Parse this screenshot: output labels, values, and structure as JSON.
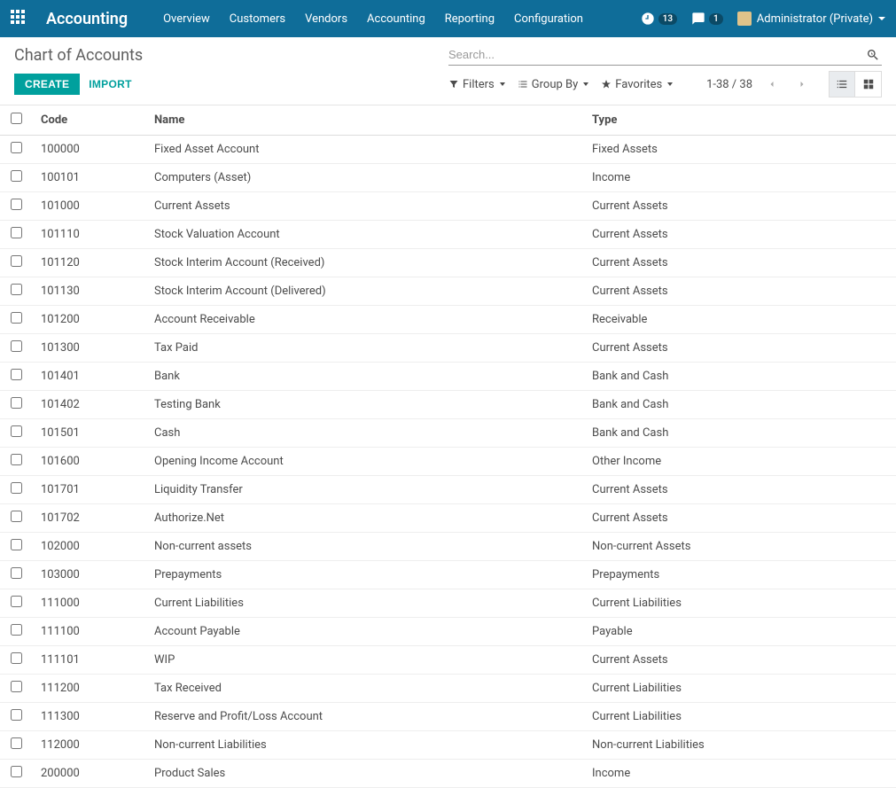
{
  "navbar": {
    "brand": "Accounting",
    "menu": [
      "Overview",
      "Customers",
      "Vendors",
      "Accounting",
      "Reporting",
      "Configuration"
    ],
    "clock_badge": "13",
    "chat_badge": "1",
    "user": "Administrator (Private)"
  },
  "control": {
    "breadcrumb": "Chart of Accounts",
    "search_placeholder": "Search...",
    "create": "CREATE",
    "import": "IMPORT",
    "filters": "Filters",
    "group_by": "Group By",
    "favorites": "Favorites",
    "pager": "1-38 / 38"
  },
  "columns": {
    "code": "Code",
    "name": "Name",
    "type": "Type"
  },
  "rows": [
    {
      "code": "100000",
      "name": "Fixed Asset Account",
      "type": "Fixed Assets"
    },
    {
      "code": "100101",
      "name": "Computers (Asset)",
      "type": "Income"
    },
    {
      "code": "101000",
      "name": "Current Assets",
      "type": "Current Assets"
    },
    {
      "code": "101110",
      "name": "Stock Valuation Account",
      "type": "Current Assets"
    },
    {
      "code": "101120",
      "name": "Stock Interim Account (Received)",
      "type": "Current Assets"
    },
    {
      "code": "101130",
      "name": "Stock Interim Account (Delivered)",
      "type": "Current Assets"
    },
    {
      "code": "101200",
      "name": "Account Receivable",
      "type": "Receivable"
    },
    {
      "code": "101300",
      "name": "Tax Paid",
      "type": "Current Assets"
    },
    {
      "code": "101401",
      "name": "Bank",
      "type": "Bank and Cash"
    },
    {
      "code": "101402",
      "name": "Testing Bank",
      "type": "Bank and Cash"
    },
    {
      "code": "101501",
      "name": "Cash",
      "type": "Bank and Cash"
    },
    {
      "code": "101600",
      "name": "Opening Income Account",
      "type": "Other Income"
    },
    {
      "code": "101701",
      "name": "Liquidity Transfer",
      "type": "Current Assets"
    },
    {
      "code": "101702",
      "name": "Authorize.Net",
      "type": "Current Assets"
    },
    {
      "code": "102000",
      "name": "Non-current assets",
      "type": "Non-current Assets"
    },
    {
      "code": "103000",
      "name": "Prepayments",
      "type": "Prepayments"
    },
    {
      "code": "111000",
      "name": "Current Liabilities",
      "type": "Current Liabilities"
    },
    {
      "code": "111100",
      "name": "Account Payable",
      "type": "Payable"
    },
    {
      "code": "111101",
      "name": "WIP",
      "type": "Current Assets"
    },
    {
      "code": "111200",
      "name": "Tax Received",
      "type": "Current Liabilities"
    },
    {
      "code": "111300",
      "name": "Reserve and Profit/Loss Account",
      "type": "Current Liabilities"
    },
    {
      "code": "112000",
      "name": "Non-current Liabilities",
      "type": "Non-current Liabilities"
    },
    {
      "code": "200000",
      "name": "Product Sales",
      "type": "Income"
    }
  ]
}
